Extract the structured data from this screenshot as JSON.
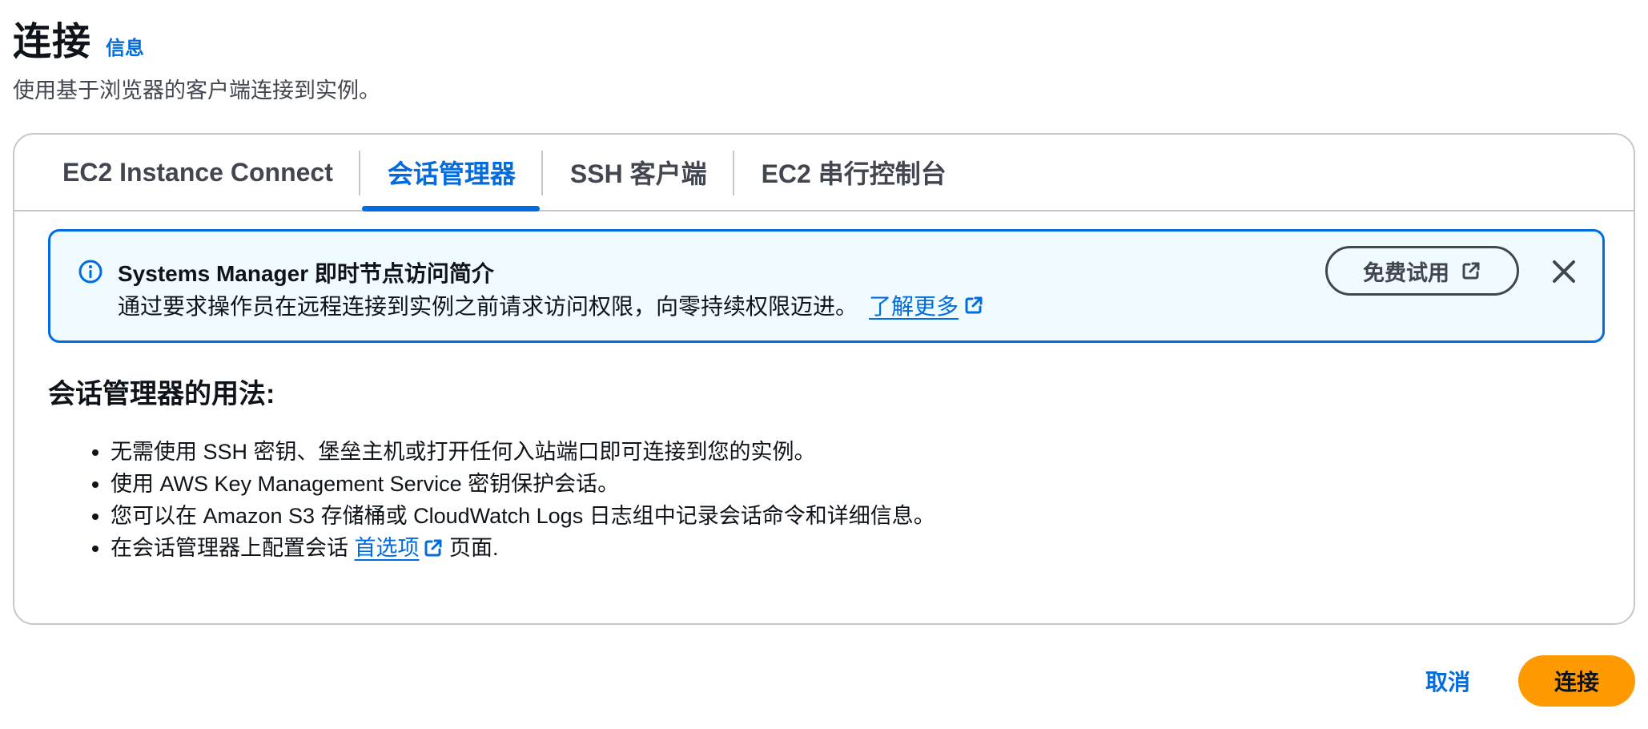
{
  "header": {
    "title": "连接",
    "info_link": "信息",
    "subtitle": "使用基于浏览器的客户端连接到实例。"
  },
  "tabs": [
    {
      "label": "EC2 Instance Connect",
      "active": false
    },
    {
      "label": "会话管理器",
      "active": true
    },
    {
      "label": "SSH 客户端",
      "active": false
    },
    {
      "label": "EC2 串行控制台",
      "active": false
    }
  ],
  "banner": {
    "icon": "info-icon",
    "title": "Systems Manager 即时节点访问简介",
    "body": "通过要求操作员在远程连接到实例之前请求访问权限，向零持续权限迈进。",
    "learn_more": "了解更多",
    "trial_button": "免费试用",
    "close_icon": "close-icon",
    "accent_color": "#006ce0"
  },
  "usage": {
    "heading": "会话管理器的用法:",
    "items": [
      "无需使用 SSH 密钥、堡垒主机或打开任何入站端口即可连接到您的实例。",
      "使用 AWS Key Management Service 密钥保护会话。",
      "您可以在 Amazon S3 存储桶或 CloudWatch Logs 日志组中记录会话命令和详细信息。"
    ],
    "last_item": {
      "prefix": "在会话管理器上配置会话 ",
      "link": "首选项",
      "suffix": " 页面."
    }
  },
  "footer": {
    "cancel": "取消",
    "connect": "连接",
    "primary_color": "#ff9900"
  }
}
